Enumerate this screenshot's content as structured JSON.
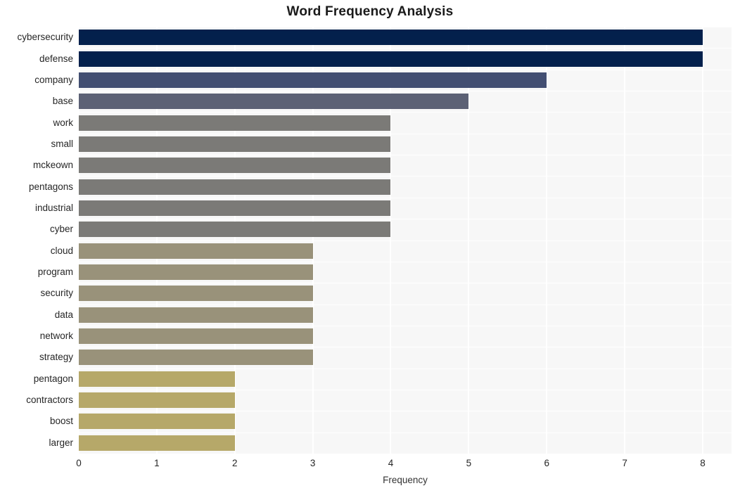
{
  "chart_data": {
    "type": "bar",
    "orientation": "horizontal",
    "title": "Word Frequency Analysis",
    "xlabel": "Frequency",
    "ylabel": "",
    "xlim": [
      0,
      8.37
    ],
    "xticks": [
      0,
      1,
      2,
      3,
      4,
      5,
      6,
      7,
      8
    ],
    "xtick_labels": [
      "0",
      "1",
      "2",
      "3",
      "4",
      "5",
      "6",
      "7",
      "8"
    ],
    "grid": true,
    "legend": "none",
    "plot_background": "#f7f7f7",
    "gridline_color": "#ffffff",
    "categories": [
      "cybersecurity",
      "defense",
      "company",
      "base",
      "work",
      "small",
      "mckeown",
      "pentagons",
      "industrial",
      "cyber",
      "cloud",
      "program",
      "security",
      "data",
      "network",
      "strategy",
      "pentagon",
      "contractors",
      "boost",
      "larger"
    ],
    "values": [
      8,
      8,
      6,
      5,
      4,
      4,
      4,
      4,
      4,
      4,
      3,
      3,
      3,
      3,
      3,
      3,
      2,
      2,
      2,
      2
    ],
    "bar_colors": [
      "#03204c",
      "#03204c",
      "#434f72",
      "#5c6175",
      "#7b7a77",
      "#7b7a77",
      "#7b7a77",
      "#7b7a77",
      "#7b7a77",
      "#7b7a77",
      "#99927a",
      "#99927a",
      "#99927a",
      "#99927a",
      "#99927a",
      "#99927a",
      "#b6a869",
      "#b6a869",
      "#b6a869",
      "#b6a869"
    ]
  }
}
